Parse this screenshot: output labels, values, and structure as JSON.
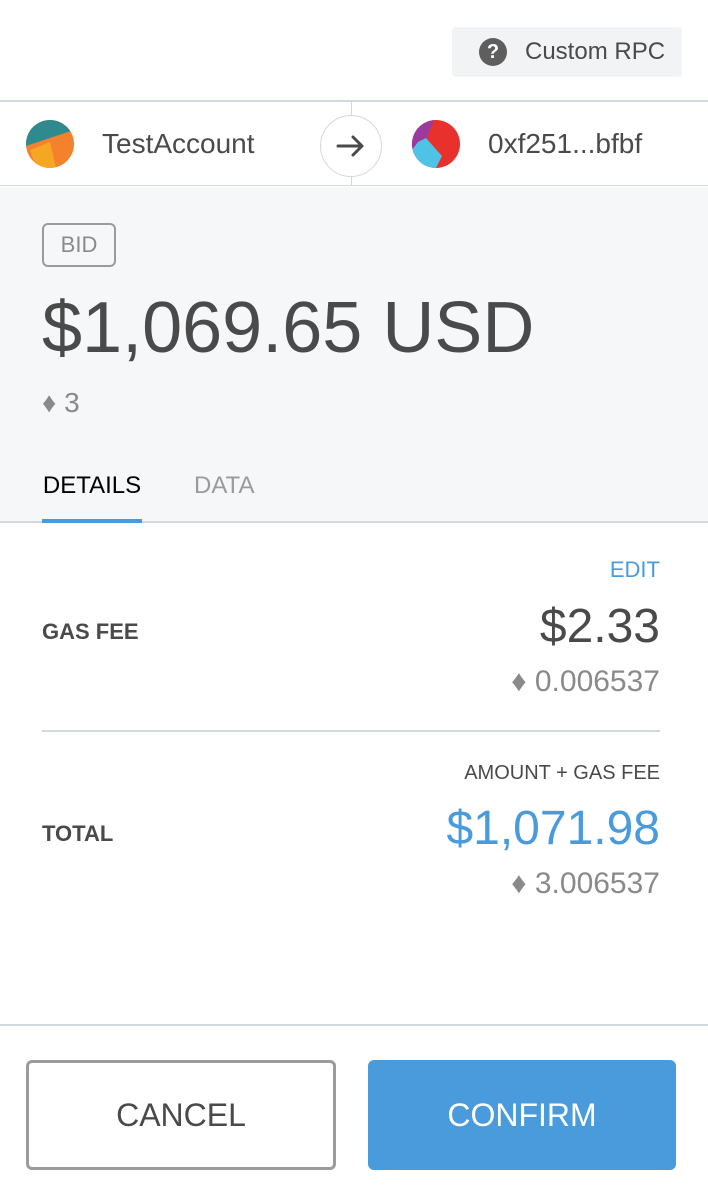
{
  "header": {
    "network_label": "Custom RPC",
    "network_icon": "question-circle-icon"
  },
  "senders": {
    "from_name": "TestAccount",
    "to_address": "0xf251...bfbf",
    "arrow_icon": "arrow-right-icon"
  },
  "summary": {
    "action": "BID",
    "amount_fiat": "$1,069.65 USD",
    "amount_eth": "♦ 3"
  },
  "tabs": [
    {
      "label": "DETAILS",
      "active": true
    },
    {
      "label": "DATA",
      "active": false
    }
  ],
  "details": {
    "edit_label": "EDIT",
    "gas_fee": {
      "label": "GAS FEE",
      "fiat": "$2.33",
      "eth": "♦ 0.006537"
    },
    "total": {
      "subheading": "AMOUNT + GAS FEE",
      "label": "TOTAL",
      "fiat": "$1,071.98",
      "eth": "♦ 3.006537"
    }
  },
  "footer": {
    "cancel_label": "CANCEL",
    "confirm_label": "CONFIRM"
  },
  "colors": {
    "accent": "#4a9bdc",
    "text": "#4a4a4a",
    "muted": "#8a8a8a",
    "summary_bg": "#f5f7f8",
    "border": "#d2d8dd"
  }
}
